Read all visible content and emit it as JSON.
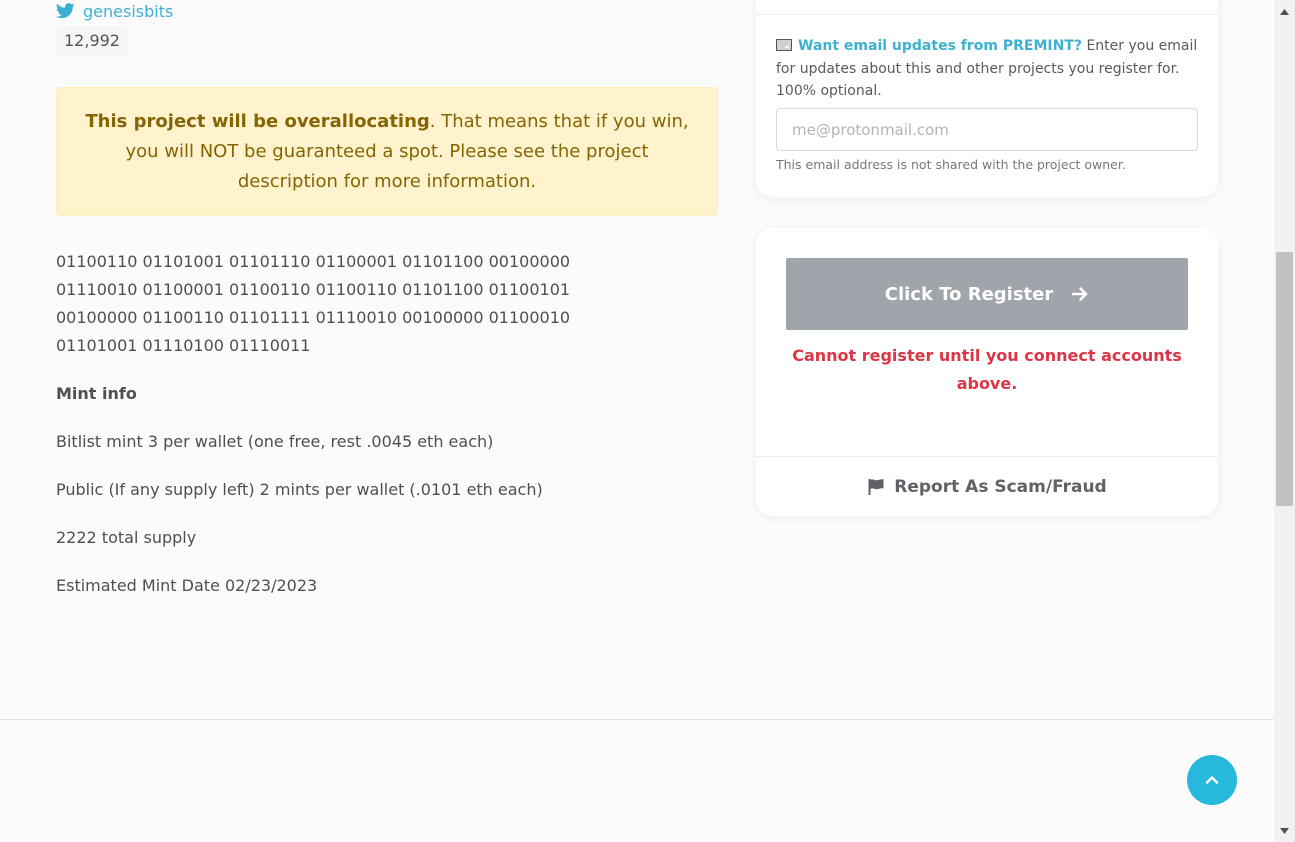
{
  "twitter": {
    "handle": "genesisbits",
    "follower_count": "12,992",
    "icon": "twitter-icon"
  },
  "alert": {
    "bold": "This project will be overallocating",
    "rest": ". That means that if you win, you will NOT be guaranteed a spot. Please see the project description for more information."
  },
  "description": {
    "binary": "01100110 01101001 01101110 01100001 01101100 00100000 01110010 01100001 01100110 01100110 01101100 01100101 00100000 01100110 01101111 01110010 00100000 01100010 01101001 01110100 01110011",
    "mint_info_title": "Mint info",
    "lines": [
      "Bitlist mint 3 per wallet (one free, rest .0045 eth each)",
      "Public (If any supply left) 2 mints per wallet (.0101 eth each)",
      "2222 total supply",
      "Estimated Mint Date 02/23/2023"
    ]
  },
  "email_card": {
    "icon": "envelope-icon",
    "cta": "Want email updates from PREMINT?",
    "text": " Enter you email for updates about this and other projects you register for. 100% optional.",
    "placeholder": "me@protonmail.com",
    "note": "This email address is not shared with the project owner."
  },
  "register_card": {
    "button_label": "Click To Register",
    "button_icon": "arrow-right-icon",
    "error": "Cannot register until you connect accounts above.",
    "report_label": "Report As Scam/Fraud",
    "report_icon": "flag-icon"
  },
  "back_to_top": {
    "icon": "chevron-up-icon"
  },
  "colors": {
    "accent": "#3eb1d0",
    "alert_bg": "#fff3cd",
    "alert_text": "#856404",
    "error": "#dc3545",
    "button_disabled": "#a0a4ab",
    "back_to_top": "#27b8dc"
  }
}
